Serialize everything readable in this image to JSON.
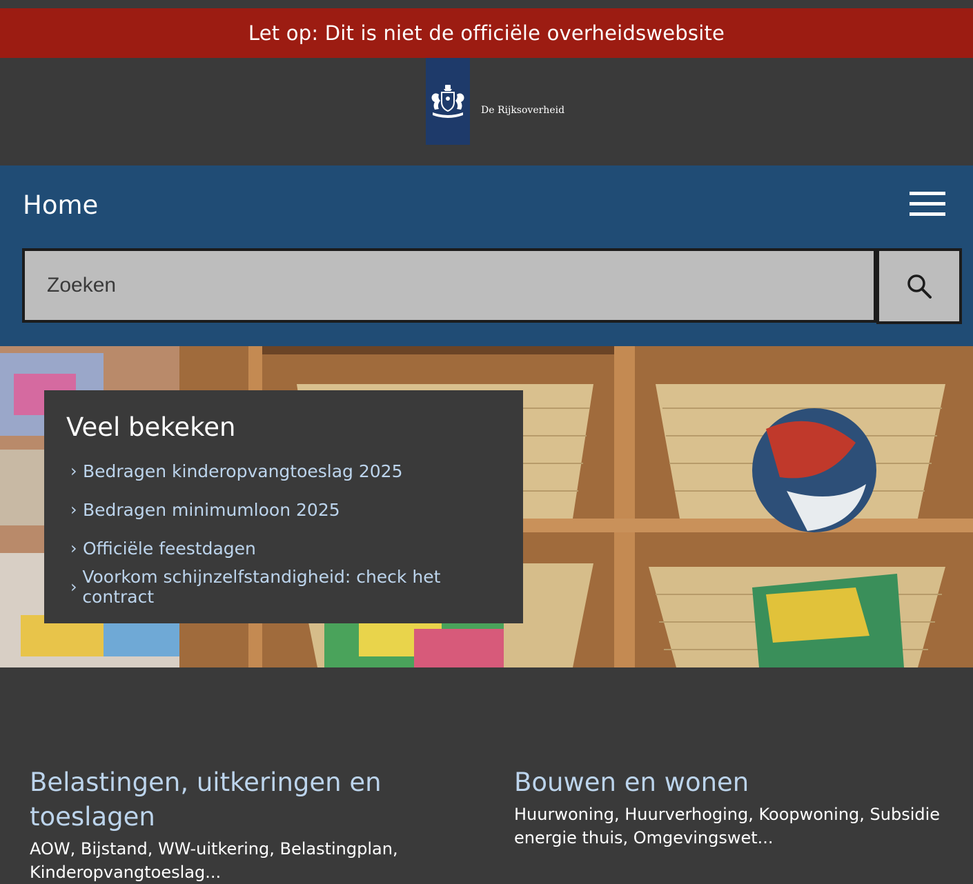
{
  "warning_banner": "Let op: Dit is niet de officiële overheidswebsite",
  "logo": {
    "name": "De Rijksoverheid",
    "ribbon_color": "#1e3a6a",
    "icon": "coat-of-arms-icon"
  },
  "nav": {
    "title": "Home",
    "menu_icon": "hamburger-menu-icon",
    "band_color": "#204c75"
  },
  "search": {
    "placeholder": "Zoeken",
    "value": "",
    "button_icon": "search-icon"
  },
  "popular": {
    "heading": "Veel bekeken",
    "links": [
      "Bedragen kinderopvangtoeslag 2025",
      "Bedragen minimumloon 2025",
      "Officiële feestdagen",
      "Voorkom schijnzelfstandigheid: check het contract"
    ]
  },
  "topics": [
    {
      "title": "Belastingen, uitkeringen en toeslagen",
      "description": "AOW, Bijstand, WW-uitkering, Belastingplan, Kinderopvangtoeslag..."
    },
    {
      "title": "Bouwen en wonen",
      "description": "Huurwoning, Huurverhoging, Koopwoning, Subsidie energie thuis, Omgevingswet..."
    }
  ],
  "colors": {
    "warning": "#9c1c12",
    "background": "#3a3a3a",
    "link": "#bcd4ec"
  }
}
